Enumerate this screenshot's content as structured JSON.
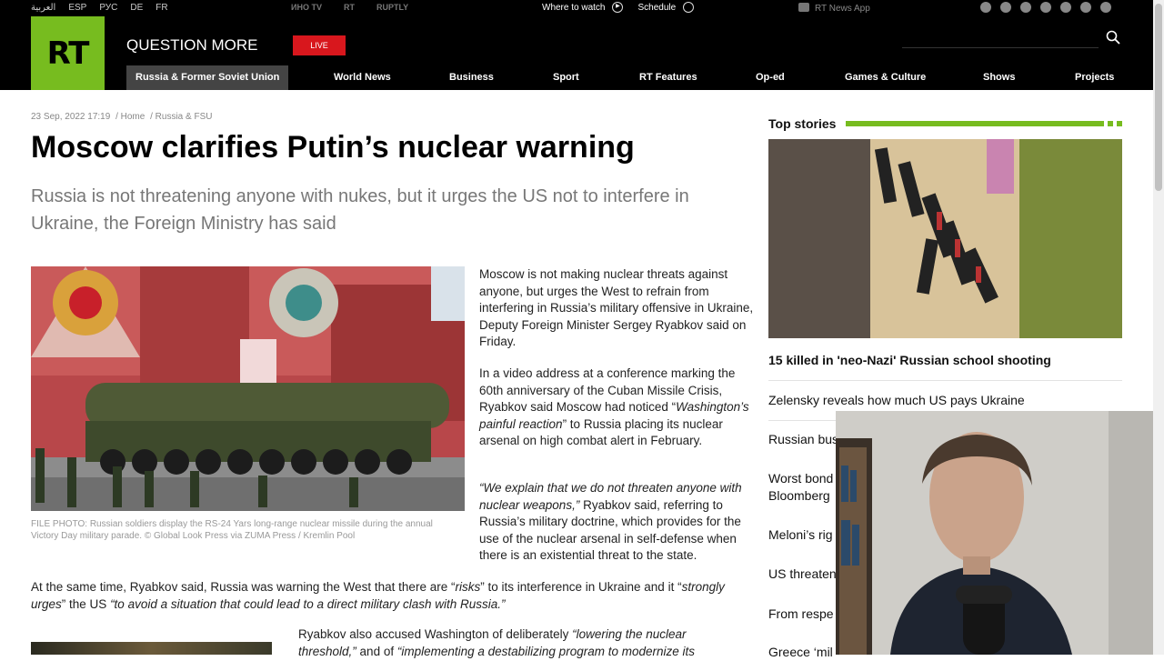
{
  "utilbar": {
    "languages": [
      "العربية",
      "ESP",
      "РУС",
      "DE",
      "FR"
    ],
    "brands": [
      "ИНО TV",
      "RT",
      "RUPTLY"
    ],
    "where_to_watch": "Where to watch",
    "schedule": "Schedule",
    "news_app": "RT News App"
  },
  "header": {
    "logo": "RT",
    "tagline": "QUESTION MORE",
    "live": "LIVE",
    "nav": [
      "Russia & Former Soviet Union",
      "World News",
      "Business",
      "Sport",
      "RT Features",
      "Op-ed",
      "Games & Culture",
      "Shows",
      "Projects"
    ]
  },
  "article": {
    "date": "23 Sep, 2022 17:19",
    "crumb_home": "/ Home",
    "crumb_section": "/ Russia & FSU",
    "headline": "Moscow clarifies Putin’s nuclear warning",
    "summary": "Russia is not threatening anyone with nukes, but it urges the US not to interfere in Ukraine, the Foreign Ministry has said",
    "caption": "FILE PHOTO: Russian soldiers display the RS-24 Yars long-range nuclear missile during the annual Victory Day military parade. © Global Look Press via ZUMA Press / Kremlin Pool",
    "p1": "Moscow is not making nuclear threats against anyone, but urges the West to refrain from interfering in Russia’s military offensive in Ukraine, Deputy Foreign Minister Sergey Ryabkov said on Friday.",
    "p2_a": "In a video address at a conference marking the 60th anniversary of the Cuban Missile Crisis, Ryabkov said Moscow had noticed “",
    "p2_quote": "Washington’s painful reaction",
    "p2_b": "” to Russia placing its nuclear arsenal on high combat alert in February.",
    "p3_quote": "“We explain that we do not threaten anyone with nuclear weapons,”",
    "p3_b": " Ryabkov said, referring to Russia’s military doctrine, which provides for the use of the nuclear arsenal in self-defense when there is an existential threat to the state.",
    "p4_a": "At the same time, Ryabkov said, Russia was warning the West that there are “",
    "p4_q1": "risks",
    "p4_b": "” to its interference in Ukraine and it “",
    "p4_q2": "strongly urges",
    "p4_c": "” the US ",
    "p4_q3": "“to avoid a situation that could lead to a direct military clash with Russia.”",
    "p5_a": "Ryabkov also accused Washington of deliberately ",
    "p5_q1": "“lowering the nuclear threshold,”",
    "p5_b": " and of ",
    "p5_q2": "“implementing a destabilizing program to modernize its"
  },
  "sidebar": {
    "title": "Top stories",
    "lead": "15 killed in 'neo-Nazi' Russian school shooting",
    "stories": [
      "Zelensky reveals how much US pays Ukraine",
      "Russian bus",
      "Worst bond",
      "Bloomberg",
      "Meloni’s rig",
      "US threaten",
      "From respe",
      "Greece ‘mil"
    ]
  }
}
